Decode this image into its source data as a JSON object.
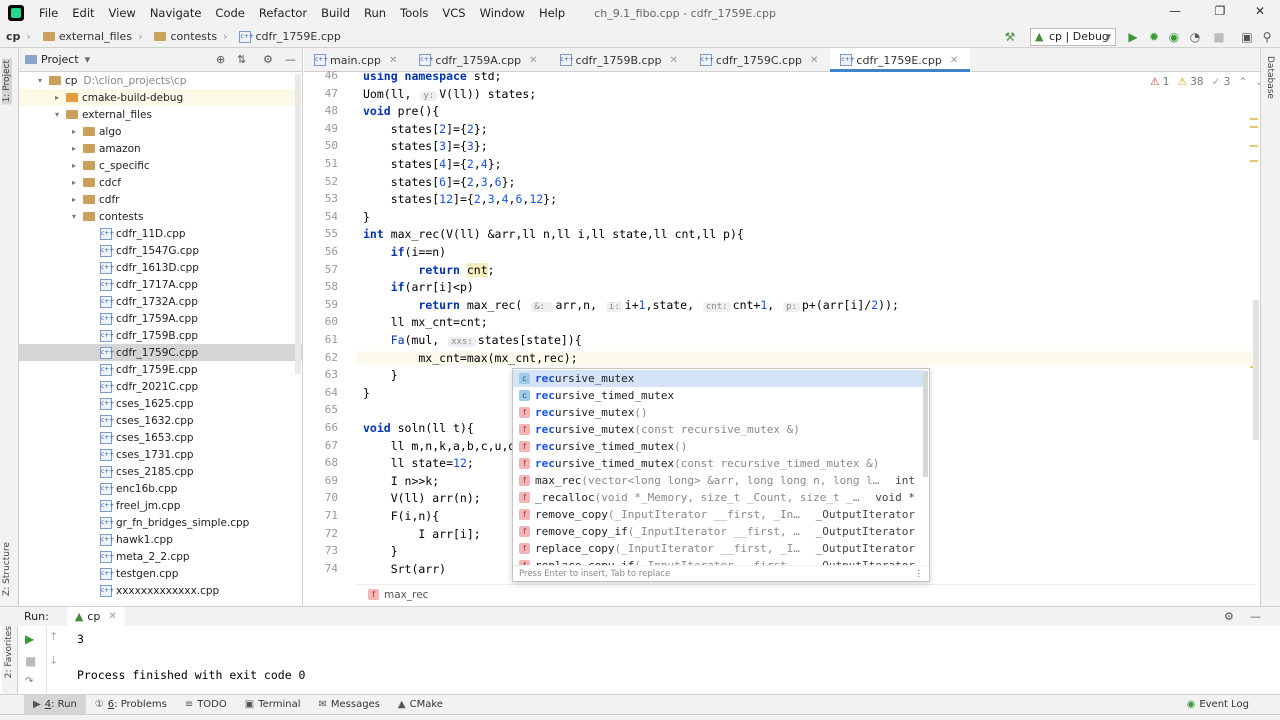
{
  "menubar": {
    "items": [
      "File",
      "Edit",
      "View",
      "Navigate",
      "Code",
      "Refactor",
      "Build",
      "Run",
      "Tools",
      "VCS",
      "Window",
      "Help"
    ],
    "window_title": "ch_9.1_fibo.cpp - cdfr_1759E.cpp"
  },
  "navbar": {
    "crumbs": [
      "cp",
      "external_files",
      "contests",
      "cdfr_1759E.cpp"
    ],
    "run_config": "cp | Debug"
  },
  "left_strip": {
    "project_tab": "1: Project",
    "structure_tab": "Z: Structure",
    "favorites_tab": "2: Favorites"
  },
  "right_strip": {
    "database_tab": "Database"
  },
  "project": {
    "title": "Project",
    "tree": [
      {
        "label": "cp",
        "extra": "D:\\clion_projects\\cp",
        "depth": 0,
        "kind": "folder",
        "expanded": true
      },
      {
        "label": "cmake-build-debug",
        "depth": 1,
        "kind": "folder-orange",
        "expanded": false
      },
      {
        "label": "external_files",
        "depth": 1,
        "kind": "folder",
        "expanded": true
      },
      {
        "label": "algo",
        "depth": 2,
        "kind": "folder",
        "expanded": false
      },
      {
        "label": "amazon",
        "depth": 2,
        "kind": "folder",
        "expanded": false
      },
      {
        "label": "c_specific",
        "depth": 2,
        "kind": "folder",
        "expanded": false
      },
      {
        "label": "cdcf",
        "depth": 2,
        "kind": "folder",
        "expanded": false
      },
      {
        "label": "cdfr",
        "depth": 2,
        "kind": "folder",
        "expanded": false
      },
      {
        "label": "contests",
        "depth": 2,
        "kind": "folder",
        "expanded": true
      },
      {
        "label": "cdfr_11D.cpp",
        "depth": 3,
        "kind": "file"
      },
      {
        "label": "cdfr_1547G.cpp",
        "depth": 3,
        "kind": "file"
      },
      {
        "label": "cdfr_1613D.cpp",
        "depth": 3,
        "kind": "file"
      },
      {
        "label": "cdfr_1717A.cpp",
        "depth": 3,
        "kind": "file"
      },
      {
        "label": "cdfr_1732A.cpp",
        "depth": 3,
        "kind": "file"
      },
      {
        "label": "cdfr_1759A.cpp",
        "depth": 3,
        "kind": "file"
      },
      {
        "label": "cdfr_1759B.cpp",
        "depth": 3,
        "kind": "file"
      },
      {
        "label": "cdfr_1759C.cpp",
        "depth": 3,
        "kind": "file",
        "selected": true
      },
      {
        "label": "cdfr_1759E.cpp",
        "depth": 3,
        "kind": "file"
      },
      {
        "label": "cdfr_2021C.cpp",
        "depth": 3,
        "kind": "file"
      },
      {
        "label": "cses_1625.cpp",
        "depth": 3,
        "kind": "file"
      },
      {
        "label": "cses_1632.cpp",
        "depth": 3,
        "kind": "file"
      },
      {
        "label": "cses_1653.cpp",
        "depth": 3,
        "kind": "file"
      },
      {
        "label": "cses_1731.cpp",
        "depth": 3,
        "kind": "file"
      },
      {
        "label": "cses_2185.cpp",
        "depth": 3,
        "kind": "file"
      },
      {
        "label": "enc16b.cpp",
        "depth": 3,
        "kind": "file"
      },
      {
        "label": "freel_jm.cpp",
        "depth": 3,
        "kind": "file"
      },
      {
        "label": "gr_fn_bridges_simple.cpp",
        "depth": 3,
        "kind": "file"
      },
      {
        "label": "hawk1.cpp",
        "depth": 3,
        "kind": "file"
      },
      {
        "label": "meta_2_2.cpp",
        "depth": 3,
        "kind": "file"
      },
      {
        "label": "testgen.cpp",
        "depth": 3,
        "kind": "file"
      },
      {
        "label": "xxxxxxxxxxxxx.cpp",
        "depth": 3,
        "kind": "file"
      }
    ]
  },
  "editor": {
    "tabs": [
      {
        "label": "main.cpp",
        "active": false
      },
      {
        "label": "cdfr_1759A.cpp",
        "active": false
      },
      {
        "label": "cdfr_1759B.cpp",
        "active": false
      },
      {
        "label": "cdfr_1759C.cpp",
        "active": false
      },
      {
        "label": "cdfr_1759E.cpp",
        "active": true
      }
    ],
    "inspections": {
      "errors": "1",
      "warnings": "38",
      "weak": "3"
    },
    "breadcrumb": "max_rec",
    "lines": [
      {
        "n": "46",
        "html": "<span class=\"kw\">using namespace</span> std;"
      },
      {
        "n": "47",
        "html": "Uom(ll, <span class=\"hint\">y:</span>V(ll)) states;"
      },
      {
        "n": "48",
        "html": "<span class=\"kw\">void</span> pre(){"
      },
      {
        "n": "49",
        "html": "    states[<span class=\"num\">2</span>]={<span class=\"num\">2</span>};"
      },
      {
        "n": "50",
        "html": "    states[<span class=\"num\">3</span>]={<span class=\"num\">3</span>};"
      },
      {
        "n": "51",
        "html": "    states[<span class=\"num\">4</span>]={<span class=\"num\">2</span>,<span class=\"num\">4</span>};"
      },
      {
        "n": "52",
        "html": "    states[<span class=\"num\">6</span>]={<span class=\"num\">2</span>,<span class=\"num\">3</span>,<span class=\"num\">6</span>};"
      },
      {
        "n": "53",
        "html": "    states[<span class=\"num\">12</span>]={<span class=\"num\">2</span>,<span class=\"num\">3</span>,<span class=\"num\">4</span>,<span class=\"num\">6</span>,<span class=\"num\">12</span>};"
      },
      {
        "n": "54",
        "html": "}"
      },
      {
        "n": "55",
        "html": "<span class=\"kw\">int</span> max_rec(V(ll) &amp;arr,ll n,ll i,ll state,ll cnt,ll p){"
      },
      {
        "n": "56",
        "html": "    <span class=\"kw\">if</span>(i==n)"
      },
      {
        "n": "57",
        "html": "        <span class=\"kw\">return</span> <span style=\"background:#f6efc0\">cnt</span>;"
      },
      {
        "n": "58",
        "html": "    <span class=\"kw\">if</span>(arr[i]&lt;p)"
      },
      {
        "n": "59",
        "html": "        <span class=\"kw\">return</span> max_rec( <span class=\"hint\">&amp;: </span>arr,n, <span class=\"hint\">i:</span>i+<span class=\"num\">1</span>,state, <span class=\"hint\">cnt:</span>cnt+<span class=\"num\">1</span>, <span class=\"hint\">p:</span>p+(arr[i]/<span class=\"num\">2</span>));"
      },
      {
        "n": "60",
        "html": "    ll mx_cnt=cnt;"
      },
      {
        "n": "61",
        "html": "    <span class=\"macro\">Fa</span>(mul, <span class=\"hint\">xxs:</span>states[state]){"
      },
      {
        "n": "62",
        "html": "        mx_cnt=max(mx_cnt,rec);",
        "current": true
      },
      {
        "n": "63",
        "html": "    }"
      },
      {
        "n": "64",
        "html": "}"
      },
      {
        "n": "65",
        "html": ""
      },
      {
        "n": "66",
        "html": "<span class=\"kw\">void</span> soln(ll t){"
      },
      {
        "n": "67",
        "html": "    ll m,n,k,a,b,c,u,d,"
      },
      {
        "n": "68",
        "html": "    ll state=<span class=\"num\">12</span>;"
      },
      {
        "n": "69",
        "html": "    I n&gt;&gt;k;"
      },
      {
        "n": "70",
        "html": "    V(ll) arr(n);"
      },
      {
        "n": "71",
        "html": "    F(i,n){"
      },
      {
        "n": "72",
        "html": "        I arr[i];"
      },
      {
        "n": "73",
        "html": "    }"
      },
      {
        "n": "74",
        "html": "    Srt(arr)"
      }
    ]
  },
  "completion": {
    "items": [
      {
        "badge": "c",
        "match": "rec",
        "rest": "ursive_mutex",
        "sig": "",
        "ret": "",
        "selected": true
      },
      {
        "badge": "c",
        "match": "rec",
        "rest": "ursive_timed_mutex",
        "sig": "",
        "ret": ""
      },
      {
        "badge": "f",
        "match": "rec",
        "rest": "ursive_mutex",
        "sig": "()",
        "ret": ""
      },
      {
        "badge": "f",
        "match": "rec",
        "rest": "ursive_mutex",
        "sig": "(const recursive_mutex &)",
        "ret": ""
      },
      {
        "badge": "f",
        "match": "rec",
        "rest": "ursive_timed_mutex",
        "sig": "()",
        "ret": ""
      },
      {
        "badge": "f",
        "match": "rec",
        "rest": "ursive_timed_mutex",
        "sig": "(const recursive_timed_mutex &)",
        "ret": ""
      },
      {
        "badge": "f",
        "match": "",
        "rest": "max_rec",
        "sig": "(vector<long long> &arr, long long n, long l…",
        "ret": "int"
      },
      {
        "badge": "f",
        "match": "",
        "rest": "_recalloc",
        "sig": "(void *_Memory, size_t _Count, size_t _…",
        "ret": "void *"
      },
      {
        "badge": "f",
        "match": "",
        "rest": "remove_copy",
        "sig": "(_InputIterator __first, _In…",
        "ret": "_OutputIterator"
      },
      {
        "badge": "f",
        "match": "",
        "rest": "remove_copy_if",
        "sig": "(_InputIterator __first, …",
        "ret": "_OutputIterator"
      },
      {
        "badge": "f",
        "match": "",
        "rest": "replace_copy",
        "sig": "(_InputIterator __first, _I…",
        "ret": "_OutputIterator"
      },
      {
        "badge": "f",
        "match": "",
        "rest": "replace_copy_if",
        "sig": "(_InputIterator __first…",
        "ret": "_OutputIterator"
      }
    ],
    "footer": "Press Enter to insert, Tab to replace"
  },
  "run": {
    "label": "Run:",
    "config_tab": "cp",
    "output": [
      "3",
      "",
      "Process finished with exit code 0"
    ]
  },
  "bottombar": {
    "tabs": [
      {
        "num": "4",
        "label": ": Run",
        "active": true
      },
      {
        "num": "6",
        "label": ": Problems"
      },
      {
        "num": "",
        "label": "TODO"
      },
      {
        "num": "",
        "label": "Terminal"
      },
      {
        "num": "",
        "label": "Messages"
      },
      {
        "num": "",
        "label": "CMake"
      }
    ],
    "event_log": "Event Log"
  }
}
